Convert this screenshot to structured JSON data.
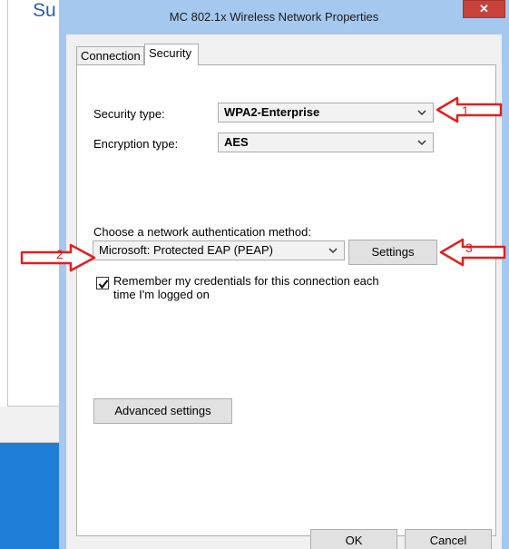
{
  "background": {
    "title_fragment": "Su"
  },
  "dialog": {
    "title": "MC 802.1x Wireless Network Properties",
    "close_glyph": "✕",
    "tabs": [
      {
        "label": "Connection",
        "selected": false
      },
      {
        "label": "Security",
        "selected": true
      }
    ],
    "security_type": {
      "label": "Security type:",
      "value": "WPA2-Enterprise"
    },
    "encryption_type": {
      "label": "Encryption type:",
      "value": "AES"
    },
    "auth_method": {
      "label": "Choose a network authentication method:",
      "value": "Microsoft: Protected EAP (PEAP)"
    },
    "settings_button": "Settings",
    "remember_credentials": {
      "checked": true,
      "line1": "Remember my credentials for this connection each",
      "line2": "time I'm logged on"
    },
    "advanced_button": "Advanced settings",
    "ok_button": "OK",
    "cancel_button": "Cancel"
  },
  "annotations": {
    "color": "#e02020",
    "markers": [
      "1",
      "2",
      "3"
    ]
  },
  "colors": {
    "dialog_frame": "#a5c8ee",
    "close_button": "#c7423a",
    "background_blue": "#1f7fd6",
    "accent_text": "#2a5fa8"
  }
}
